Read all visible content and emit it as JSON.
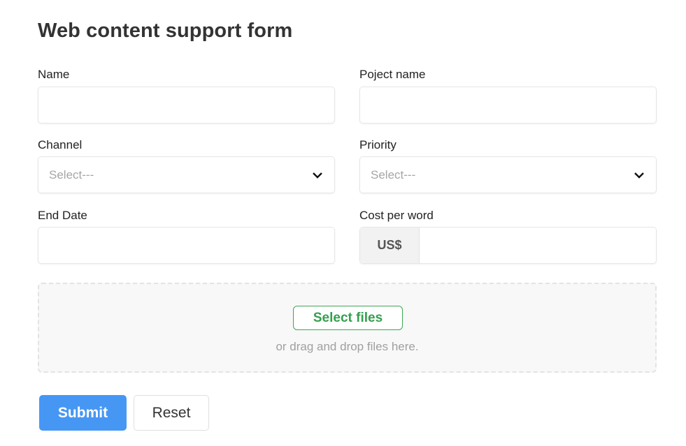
{
  "form": {
    "title": "Web content support form",
    "fields": {
      "name": {
        "label": "Name",
        "value": ""
      },
      "project_name": {
        "label": "Poject name",
        "value": ""
      },
      "channel": {
        "label": "Channel",
        "selected": "Select---"
      },
      "priority": {
        "label": "Priority",
        "selected": "Select---"
      },
      "end_date": {
        "label": "End Date",
        "value": ""
      },
      "cost_per_word": {
        "label": "Cost per word",
        "prefix": "US$",
        "value": ""
      }
    },
    "dropzone": {
      "button_label": "Select files",
      "hint": "or drag and drop files here."
    },
    "actions": {
      "submit_label": "Submit",
      "reset_label": "Reset"
    }
  },
  "colors": {
    "primary": "#4697f4",
    "success": "#34a04e"
  }
}
